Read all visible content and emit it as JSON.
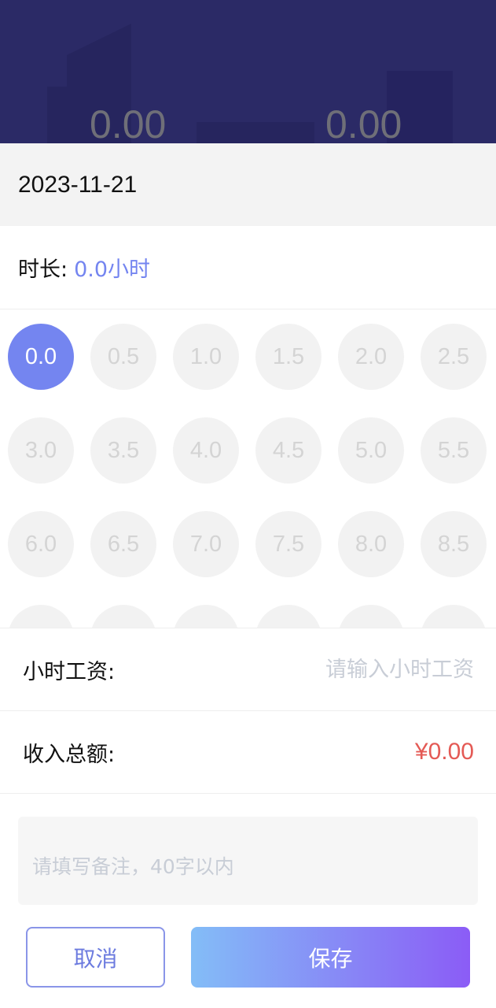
{
  "header": {
    "left_value": "0.00",
    "right_value": "0.00"
  },
  "date": "2023-11-21",
  "duration": {
    "label": "时长:",
    "value": "0.0小时"
  },
  "hour_options": [
    "0.0",
    "0.5",
    "1.0",
    "1.5",
    "2.0",
    "2.5",
    "3.0",
    "3.5",
    "4.0",
    "4.5",
    "5.0",
    "5.5",
    "6.0",
    "6.5",
    "7.0",
    "7.5",
    "8.0",
    "8.5"
  ],
  "selected_option": "0.0",
  "hourly_wage": {
    "label": "小时工资:",
    "placeholder": "请输入小时工资"
  },
  "total_income": {
    "label": "收入总额:",
    "value": "¥0.00"
  },
  "note": {
    "placeholder": "请填写备注，40字以内"
  },
  "buttons": {
    "cancel": "取消",
    "save": "保存"
  },
  "colors": {
    "accent": "#7485f0",
    "amount_red": "#e45a55",
    "header_bg": "#2b2a66"
  }
}
